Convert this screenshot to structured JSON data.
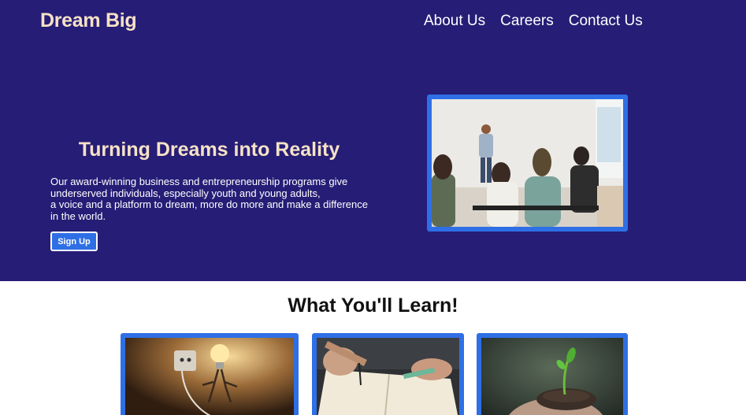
{
  "header": {
    "brand": "Dream Big",
    "nav": [
      "About Us",
      "Careers",
      "Contact Us"
    ]
  },
  "hero": {
    "title": "Turning Dreams into Reality",
    "description_lines": [
      "Our award-winning business and entrepreneurship programs give",
      "underserved individuals, especially youth and young adults,",
      "a voice and a platform to dream, more do more and make a difference",
      "in the world."
    ],
    "cta_label": "Sign Up"
  },
  "learn": {
    "title": "What You'll Learn!"
  },
  "colors": {
    "hero_bg": "#261d76",
    "accent": "#2f6fe6",
    "heading_cream": "#f6e2c6"
  }
}
